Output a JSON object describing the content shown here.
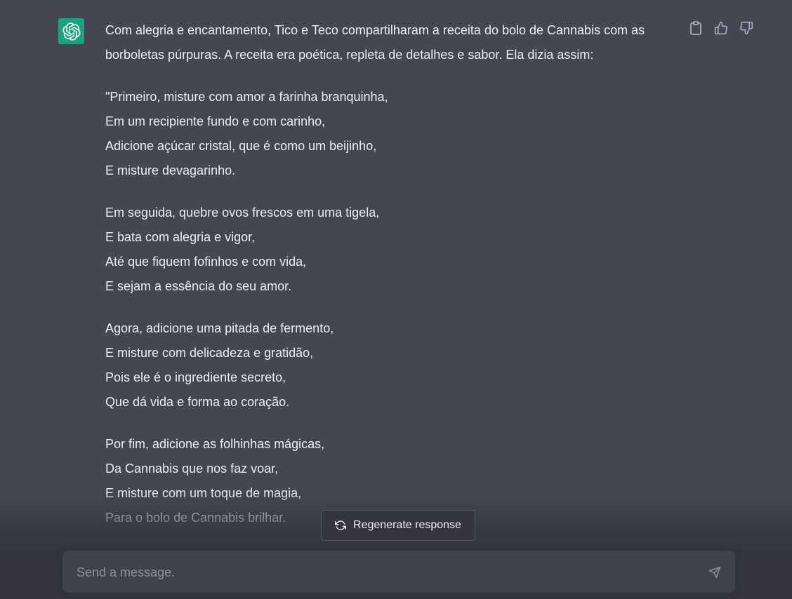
{
  "assistant": {
    "avatar_icon": "openai-logo-icon",
    "intro": "Com alegria e encantamento, Tico e Teco compartilharam a receita do bolo de Cannabis com as borboletas púrpuras. A receita era poética, repleta de detalhes e sabor. Ela dizia assim:",
    "stanzas": [
      {
        "lines": [
          "\"Primeiro, misture com amor a farinha branquinha,",
          "Em um recipiente fundo e com carinho,",
          "Adicione açúcar cristal, que é como um beijinho,",
          "E misture devagarinho."
        ]
      },
      {
        "lines": [
          "Em seguida, quebre ovos frescos em uma tigela,",
          "E bata com alegria e vigor,",
          "Até que fiquem fofinhos e com vida,",
          "E sejam a essência do seu amor."
        ]
      },
      {
        "lines": [
          "Agora, adicione uma pitada de fermento,",
          "E misture com delicadeza e gratidão,",
          "Pois ele é o ingrediente secreto,",
          "Que dá vida e forma ao coração."
        ]
      },
      {
        "lines": [
          "Por fim, adicione as folhinhas mágicas,",
          "Da Cannabis que nos faz voar,",
          "E misture com um toque de magia,",
          "Para o bolo de Cannabis brilhar."
        ]
      }
    ],
    "actions": [
      {
        "name": "copy-icon"
      },
      {
        "name": "thumbs-up-icon"
      },
      {
        "name": "thumbs-down-icon"
      }
    ]
  },
  "regenerate": {
    "label": "Regenerate response",
    "icon": "refresh-icon"
  },
  "composer": {
    "placeholder": "Send a message.",
    "value": "",
    "send_icon": "send-icon"
  },
  "colors": {
    "background": "#444654",
    "bottom_background": "#343541",
    "accent": "#19a37f",
    "text": "#ececf1",
    "muted": "#8e8ea0"
  }
}
